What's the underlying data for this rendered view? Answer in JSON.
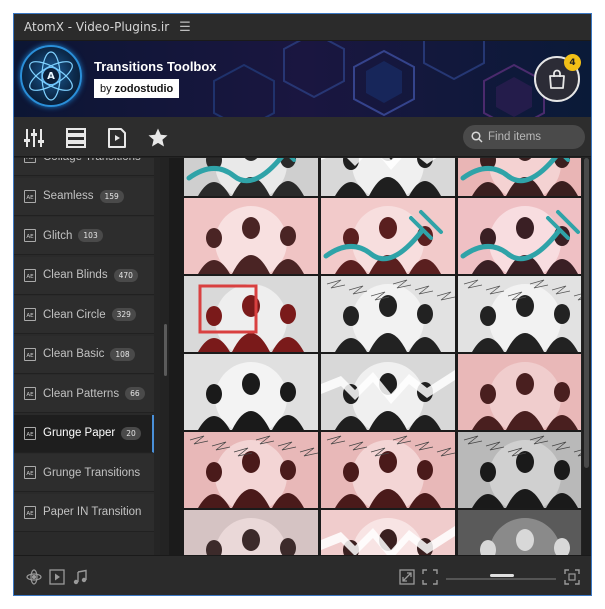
{
  "window": {
    "title": "AtomX - Video-Plugins.ir",
    "menu_icon": "hamburger-icon"
  },
  "banner": {
    "logo_letter": "A",
    "title": "Transitions Toolbox",
    "by_prefix": "by",
    "author": "zodostudio",
    "cart_count": "4",
    "accent": "#2a8fd9",
    "badge_color": "#f2c017"
  },
  "toolbar": {
    "icons": [
      "sliders-icon",
      "list-icon",
      "video-file-icon",
      "star-icon"
    ],
    "search_placeholder": "Find items"
  },
  "sidebar": {
    "items": [
      {
        "label": "Collage Transitions",
        "count": ""
      },
      {
        "label": "Seamless",
        "count": "159"
      },
      {
        "label": "Glitch",
        "count": "103"
      },
      {
        "label": "Clean Blinds",
        "count": "470"
      },
      {
        "label": "Clean Circle",
        "count": "329"
      },
      {
        "label": "Clean Basic",
        "count": "108"
      },
      {
        "label": "Clean Patterns",
        "count": "66"
      },
      {
        "label": "Grunge Paper",
        "count": "20",
        "active": true
      },
      {
        "label": "Grunge Transitions",
        "count": ""
      },
      {
        "label": "Paper IN Transition",
        "count": ""
      }
    ],
    "item_icon": "ae-file-icon"
  },
  "grid": {
    "thumbnails": [
      {
        "style": "teal-brush"
      },
      {
        "style": "mono-tear"
      },
      {
        "style": "red-teal"
      },
      {
        "style": "red-collage"
      },
      {
        "style": "red-teal-stroke"
      },
      {
        "style": "pink-teal-brush"
      },
      {
        "style": "red-frame"
      },
      {
        "style": "mono-scribble"
      },
      {
        "style": "mono-scribble"
      },
      {
        "style": "mono"
      },
      {
        "style": "mono-tear"
      },
      {
        "style": "red"
      },
      {
        "style": "red-scribble"
      },
      {
        "style": "red-scribble"
      },
      {
        "style": "dark-scribble"
      },
      {
        "style": "mono-pink"
      },
      {
        "style": "pink-tear"
      },
      {
        "style": "dark-mono"
      }
    ]
  },
  "bottom": {
    "left_icons": [
      "atom-icon",
      "play-box-icon",
      "music-note-icon"
    ],
    "right_icons": [
      "expand-icon",
      "corners-icon",
      "fullscreen-icon"
    ]
  }
}
